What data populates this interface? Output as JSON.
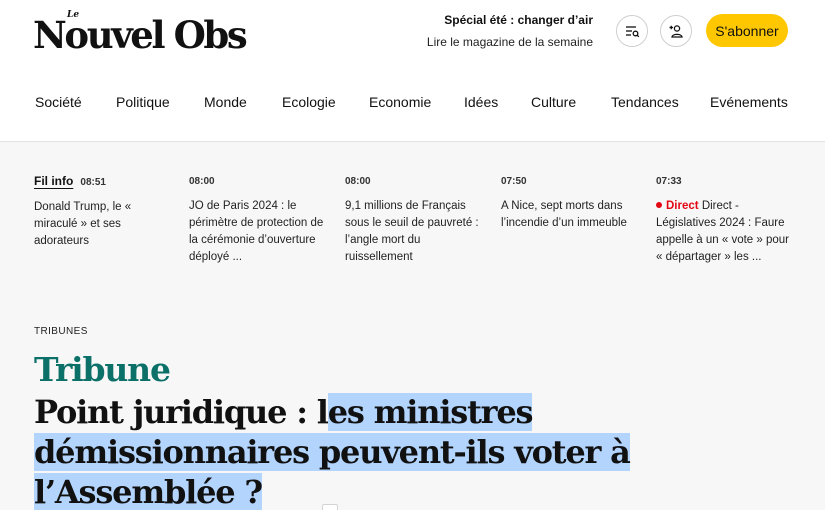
{
  "header": {
    "logo_small": "Le",
    "logo_text": "Nouvel Obs",
    "promo_title": "Spécial été : changer d’air",
    "promo_subtitle": "Lire le magazine de la semaine",
    "icons": [
      "menu-search-icon",
      "user-plus-icon"
    ],
    "subscribe_label": "S'abonner",
    "subscribe_color": "#ffc700"
  },
  "nav": {
    "items": [
      "Société",
      "Politique",
      "Monde",
      "Ecologie",
      "Economie",
      "Idées",
      "Culture",
      "Tendances",
      "Evénements"
    ]
  },
  "ticker": {
    "label": "Fil info",
    "items": [
      {
        "time": "08:51",
        "text": "Donald Trump, le « miraculé » et ses adorateurs"
      },
      {
        "time": "08:00",
        "text": "JO de Paris 2024 : le périmètre de protection de la cérémonie d’ouverture déployé ..."
      },
      {
        "time": "08:00",
        "text": "9,1 millions de Français sous le seuil de pauvreté : l’angle mort du ruissellement"
      },
      {
        "time": "07:50",
        "text": "A Nice, sept morts dans l’incendie d’un immeuble"
      },
      {
        "time": "07:33",
        "badge": "Direct",
        "text": "Direct - Législatives 2024 : Faure appelle à un « vote » pour « départager » les ..."
      }
    ],
    "live_color": "#e30613"
  },
  "article": {
    "section": "TRIBUNES",
    "kicker": "Tribune",
    "kicker_color": "#0a7068",
    "title_start": "Point juridique : l",
    "title_highlight_1": "es ministres",
    "title_highlight_2": "démissionnaires peuvent-ils voter à",
    "title_highlight_3": "l’Assemblée ?",
    "selection_color": "#b3d4fc"
  }
}
